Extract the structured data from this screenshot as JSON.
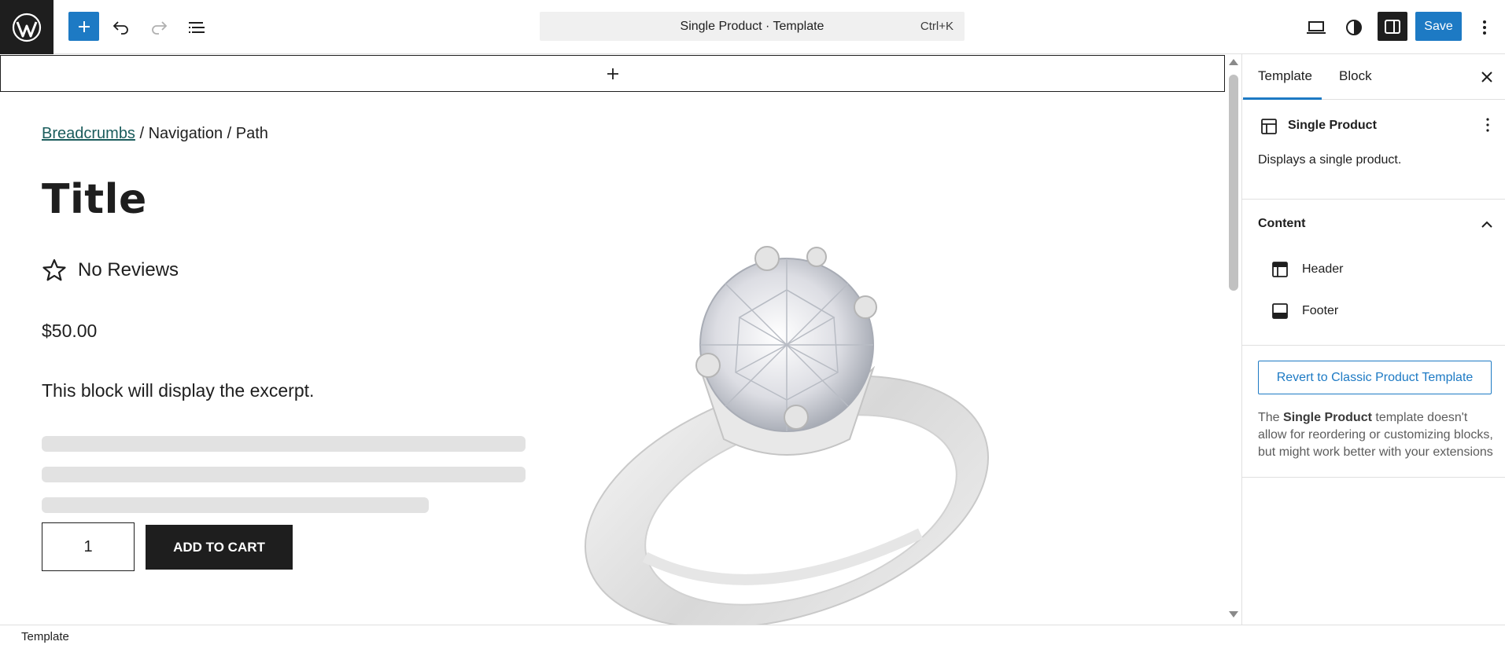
{
  "toolbar": {
    "command_title": "Single Product · Template",
    "command_shortcut": "Ctrl+K",
    "save_label": "Save",
    "icons": [
      "wordpress-logo",
      "plus-icon",
      "undo-icon",
      "redo-icon",
      "list-view-icon",
      "desktop-view-icon",
      "contrast-icon",
      "sidebar-icon",
      "more-vertical-icon"
    ],
    "accent_color": "#1d7ac4"
  },
  "canvas": {
    "breadcrumbs": {
      "link": "Breadcrumbs",
      "rest": " / Navigation / Path"
    },
    "title": "Title",
    "reviews": "No Reviews",
    "price": "$50.00",
    "excerpt": "This block will display the excerpt.",
    "quantity": "1",
    "add_to_cart": "ADD TO CART",
    "image_subject": "silver diamond ring"
  },
  "sidebar": {
    "tabs": [
      "Template",
      "Block"
    ],
    "active_tab": "Template",
    "card": {
      "title": "Single Product",
      "description": "Displays a single product."
    },
    "content": {
      "heading": "Content",
      "items": [
        {
          "label": "Header",
          "icon": "header-icon"
        },
        {
          "label": "Footer",
          "icon": "footer-icon"
        }
      ]
    },
    "revert_button": "Revert to Classic Product Template",
    "note_prefix": "The ",
    "note_bold": "Single Product",
    "note_suffix": " template doesn't allow for reordering or customizing blocks, but might work better with your extensions"
  },
  "footer": {
    "breadcrumb": "Template"
  }
}
